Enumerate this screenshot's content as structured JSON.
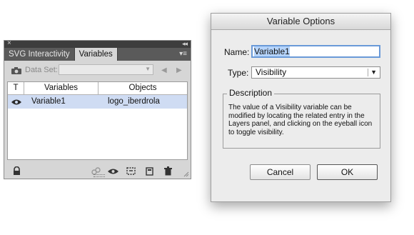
{
  "variables_panel": {
    "close_glyph": "×",
    "collapse_glyph": "◂◂",
    "menu_glyph": "▾≡",
    "tabs": [
      {
        "label": "SVG Interactivity",
        "active": false
      },
      {
        "label": "Variables",
        "active": true
      }
    ],
    "dataset_label": "Data Set:",
    "dataset_value": "",
    "select_arrow": "▼",
    "prev_glyph": "◀",
    "next_glyph": "▶",
    "columns": {
      "toggle": "T",
      "variables": "Variables",
      "objects": "Objects"
    },
    "rows": [
      {
        "icon": "eye-icon",
        "variable": "Variable1",
        "object": "logo_iberdrola",
        "selected": true
      }
    ],
    "footer_icons": [
      "lock-icon",
      "bind-to-object-icon",
      "unbind-object-icon",
      "capture-dataset-icon",
      "new-variable-icon",
      "delete-icon"
    ],
    "accent_selected_row": "#cfdcf3"
  },
  "dialog": {
    "title": "Variable Options",
    "name_label": "Name:",
    "name_value": "Variable1",
    "type_label": "Type:",
    "type_value": "Visibility",
    "type_arrow": "▼",
    "description_legend": "Description",
    "description_text": "The value of a Visibility variable can be modified by locating the related entry in the Layers panel, and clicking on the eyeball icon to toggle visibility.",
    "cancel_label": "Cancel",
    "ok_label": "OK",
    "focus_color": "#6a9ad8"
  }
}
